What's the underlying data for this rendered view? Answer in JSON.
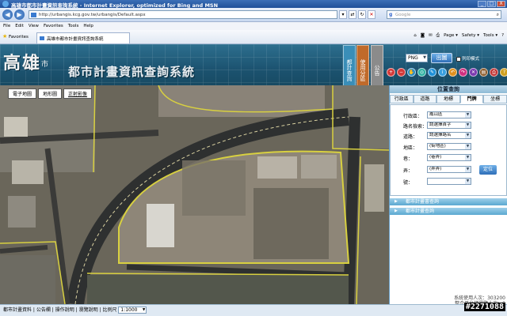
{
  "window": {
    "title": "高雄市都市計畫資訊查詢系統 - Internet Explorer, optimized for Bing and MSN",
    "min": "_",
    "max": "□",
    "close": "X"
  },
  "browser": {
    "address": "http://urbangis.kcg.gov.tw/urbangis/Default.aspx",
    "search_placeholder": "Google",
    "menu": [
      "File",
      "Edit",
      "View",
      "Favorites",
      "Tools",
      "Help"
    ],
    "favorites_label": "Favorites",
    "tab_title": "高雄市都市計畫資訊查詢系統",
    "commands": [
      "Page ▾",
      "Safety ▾",
      "Tools ▾",
      "?"
    ]
  },
  "header": {
    "logo_main": "高雄",
    "logo_small": "市",
    "system_title": "都市計畫資訊查詢系統",
    "vertical_tabs": [
      "都計查詢",
      "使用分區",
      "公告"
    ],
    "format_value": "PNG",
    "output_label": "出圖",
    "print_mode_label": "列印模式"
  },
  "map": {
    "tabs": [
      "電子地圖",
      "地形圖",
      "正射影像"
    ],
    "selected_tab": 2
  },
  "panel": {
    "title": "位置查詢",
    "tabs": [
      "行政區",
      "道路",
      "地標",
      "門牌",
      "坐標"
    ],
    "selected_tab": 3,
    "fields": [
      {
        "label": "行政區：",
        "value": "鳳山區"
      },
      {
        "label": "路名檢索：",
        "value": "請選擇首字"
      },
      {
        "label": "道路：",
        "value": "請選擇路名"
      },
      {
        "label": "地區：",
        "value": "(街地區)"
      },
      {
        "label": "巷：",
        "value": "(巷弄)"
      },
      {
        "label": "弄：",
        "value": "(弄弄)"
      },
      {
        "label": "號：",
        "value": ""
      }
    ],
    "locate_label": "定位",
    "accordions": [
      "都市計畫書查詢",
      "都市計畫查詢"
    ],
    "visitors": "系統使用人次：303200",
    "integrated": "整合平台總瀏覽人次：8"
  },
  "status": {
    "links": [
      "都市計畫資料",
      "公告欄",
      "操作說明",
      "瀏覽說明"
    ],
    "scale_label": "比例尺",
    "scale_value": "1:1000"
  },
  "watermark": "#2271088"
}
